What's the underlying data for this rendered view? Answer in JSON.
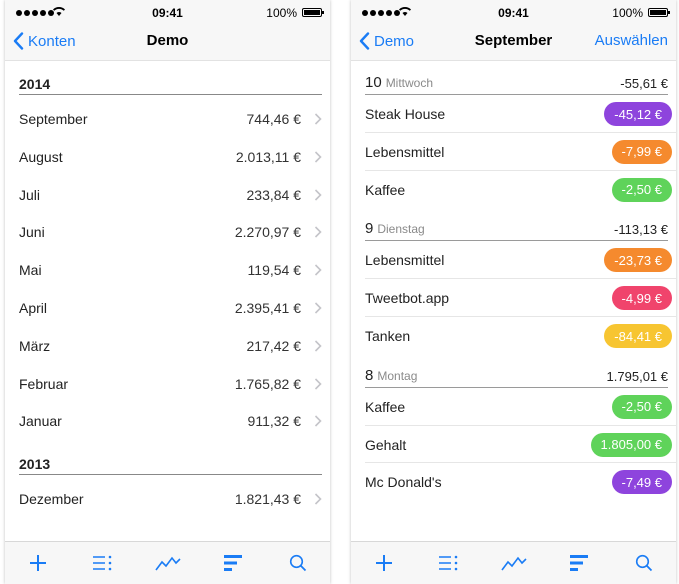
{
  "status": {
    "time": "09:41",
    "battery": "100%"
  },
  "left": {
    "nav": {
      "back": "Konten",
      "title": "Demo"
    },
    "sections": [
      {
        "year": "2014",
        "rows": [
          {
            "month": "September",
            "amount": "744,46 €"
          },
          {
            "month": "August",
            "amount": "2.013,11 €"
          },
          {
            "month": "Juli",
            "amount": "233,84 €"
          },
          {
            "month": "Juni",
            "amount": "2.270,97 €"
          },
          {
            "month": "Mai",
            "amount": "119,54 €"
          },
          {
            "month": "April",
            "amount": "2.395,41 €"
          },
          {
            "month": "März",
            "amount": "217,42 €"
          },
          {
            "month": "Februar",
            "amount": "1.765,82 €"
          },
          {
            "month": "Januar",
            "amount": "911,32 €"
          }
        ]
      },
      {
        "year": "2013",
        "rows": [
          {
            "month": "Dezember",
            "amount": "1.821,43 €"
          }
        ]
      }
    ]
  },
  "right": {
    "nav": {
      "back": "Demo",
      "title": "September",
      "action": "Auswählen"
    },
    "days": [
      {
        "num": "10",
        "name": "Mittwoch",
        "total": "-55,61 €",
        "tx": [
          {
            "name": "Steak House",
            "amount": "-45,12 €",
            "color": "#8e44dd"
          },
          {
            "name": "Lebensmittel",
            "amount": "-7,99 €",
            "color": "#f58a2e"
          },
          {
            "name": "Kaffee",
            "amount": "-2,50 €",
            "color": "#5fd35a"
          }
        ]
      },
      {
        "num": "9",
        "name": "Dienstag",
        "total": "-113,13 €",
        "tx": [
          {
            "name": "Lebensmittel",
            "amount": "-23,73 €",
            "color": "#f58a2e"
          },
          {
            "name": "Tweetbot.app",
            "amount": "-4,99 €",
            "color": "#f0446c"
          },
          {
            "name": "Tanken",
            "amount": "-84,41 €",
            "color": "#f7c531"
          }
        ]
      },
      {
        "num": "8",
        "name": "Montag",
        "total": "1.795,01 €",
        "tx": [
          {
            "name": "Kaffee",
            "amount": "-2,50 €",
            "color": "#5fd35a"
          },
          {
            "name": "Gehalt",
            "amount": "1.805,00 €",
            "color": "#5fd35a"
          },
          {
            "name": "Mc Donald's",
            "amount": "-7,49 €",
            "color": "#8e44dd"
          }
        ]
      }
    ]
  },
  "tabs": [
    "add-icon",
    "list-icon",
    "chart-line-icon",
    "bars-icon",
    "search-icon"
  ],
  "colors": {
    "accent": "#1a7cf5"
  }
}
